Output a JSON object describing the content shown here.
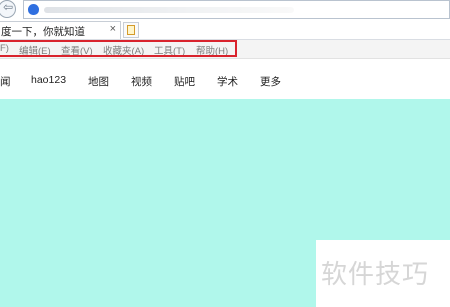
{
  "browser": {
    "back_icon": "back-arrow-icon",
    "site_icon": "baidu-paw-icon",
    "tab": {
      "title": "度一下，你就知道",
      "close": "×"
    },
    "new_tab_icon": "new-tab-icon"
  },
  "menu": {
    "items": [
      "F)",
      "编辑(E)",
      "查看(V)",
      "收藏夹(A)",
      "工具(T)",
      "帮助(H)"
    ],
    "highlight_color": "#d9232d"
  },
  "nav": {
    "items": [
      "闻",
      "hao123",
      "地图",
      "视频",
      "贴吧",
      "学术",
      "更多"
    ]
  },
  "content": {
    "background": "#b0f7eb"
  },
  "watermark": {
    "text": "软件技巧"
  }
}
